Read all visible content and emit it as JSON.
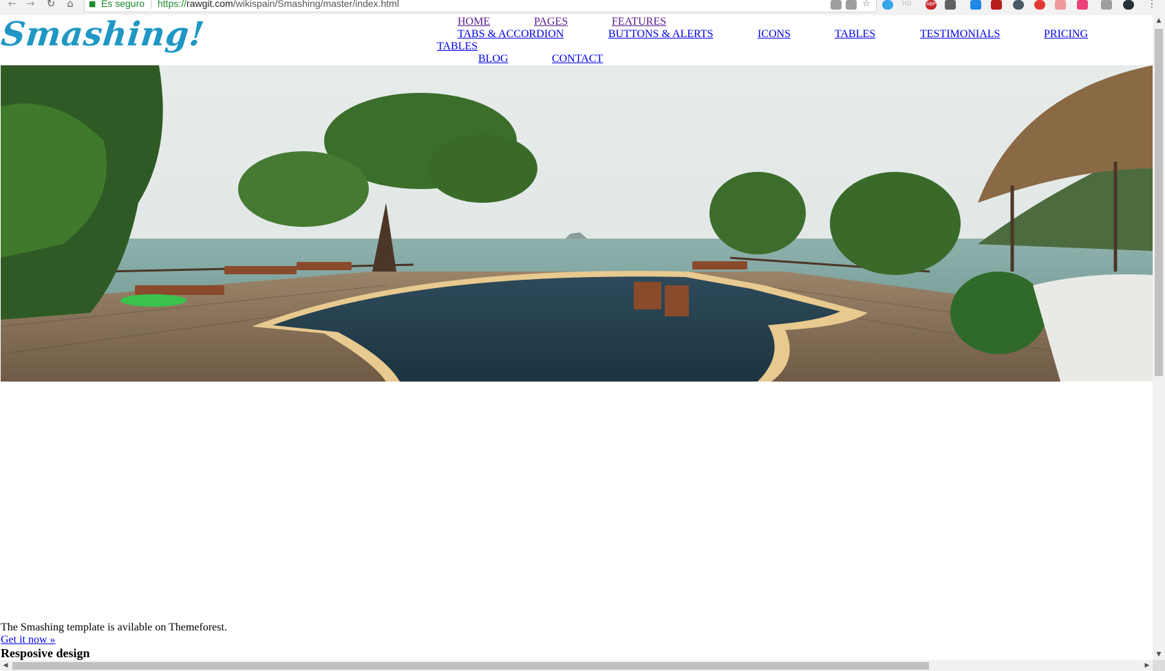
{
  "browser": {
    "secure_label": "Es seguro",
    "url_scheme": "https://",
    "url_host": "rawgit.com",
    "url_path": "/wikispain/Smashing/master/index.html",
    "ext_hd": "HD",
    "ext_abp": "ABP"
  },
  "site": {
    "logo": "Smashing!"
  },
  "nav": {
    "home": "HOME",
    "pages": "PAGES",
    "features": "FEATURES",
    "tabs_accordion": "TABS & ACCORDION",
    "buttons_alerts": "BUTTONS & ALERTS",
    "icons": "ICONS",
    "tables": "TABLES",
    "testimonials": "TESTIMONIALS",
    "pricing": "PRICING",
    "pricing_cont": "TABLES",
    "blog": "BLOG",
    "contact": "CONTACT"
  },
  "content": {
    "intro": "The Smashing template is avilable on Themeforest.",
    "cta": "Get it now »",
    "heading": "Resposive design"
  },
  "colors": {
    "logo": "#1f97c4",
    "link": "#0000ee",
    "visited": "#551a8b"
  }
}
